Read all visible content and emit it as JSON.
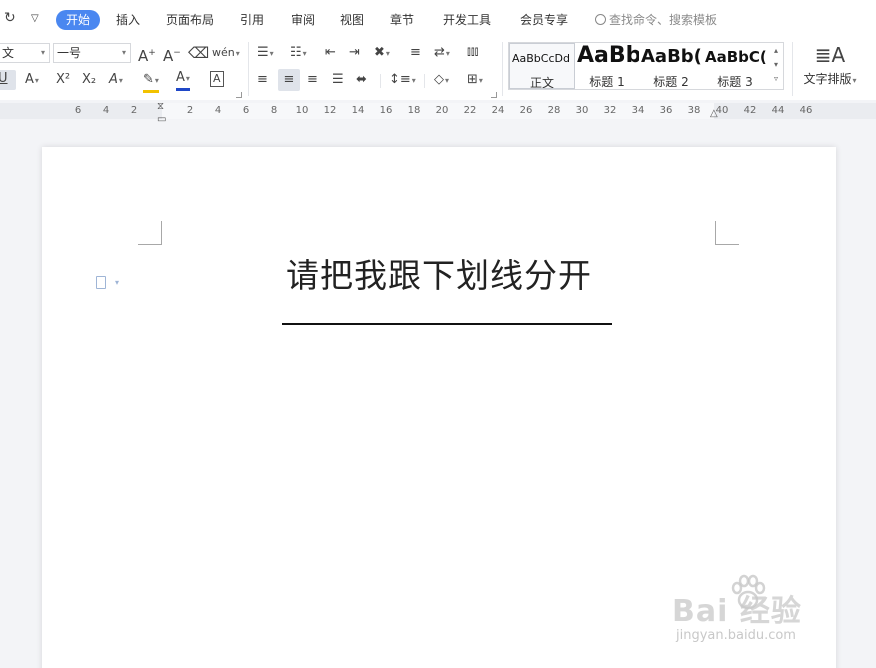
{
  "quick_access": {
    "redo_icon": "redo-icon",
    "more_icon": "chevron-down-icon"
  },
  "menu": {
    "tabs": [
      {
        "label": "开始",
        "active": true
      },
      {
        "label": "插入"
      },
      {
        "label": "页面布局"
      },
      {
        "label": "引用"
      },
      {
        "label": "审阅"
      },
      {
        "label": "视图"
      },
      {
        "label": "章节"
      },
      {
        "label": "开发工具"
      },
      {
        "label": "会员专享"
      }
    ],
    "search_placeholder": "查找命令、搜索模板"
  },
  "ribbon": {
    "font_name": "文",
    "font_size": "一号",
    "superscript_label": "X²",
    "subscript_label": "X₂",
    "phonetic_label": "wén",
    "styles": [
      {
        "sample": "AaBbCcDd",
        "name": "正文"
      },
      {
        "sample": "AaBb",
        "name": "标题 1"
      },
      {
        "sample": "AaBb(",
        "name": "标题 2"
      },
      {
        "sample": "AaBbC(",
        "name": "标题 3"
      }
    ],
    "typeset_label": "文字排版"
  },
  "ruler": {
    "left_numbers": [
      "6",
      "4",
      "2"
    ],
    "right_numbers": [
      "2",
      "4",
      "6",
      "8",
      "10",
      "12",
      "14",
      "16",
      "18",
      "20",
      "22",
      "24",
      "26",
      "28",
      "30",
      "32",
      "34",
      "36",
      "38",
      "40",
      "42",
      "44",
      "46"
    ]
  },
  "document": {
    "title": "请把我跟下划线分开"
  },
  "watermark": {
    "logo": "Bai  经验",
    "url": "jingyan.baidu.com"
  },
  "colors": {
    "accent": "#4a87f0",
    "highlight_underline": "#f2c200",
    "font_color_underline": "#1f47c7"
  }
}
